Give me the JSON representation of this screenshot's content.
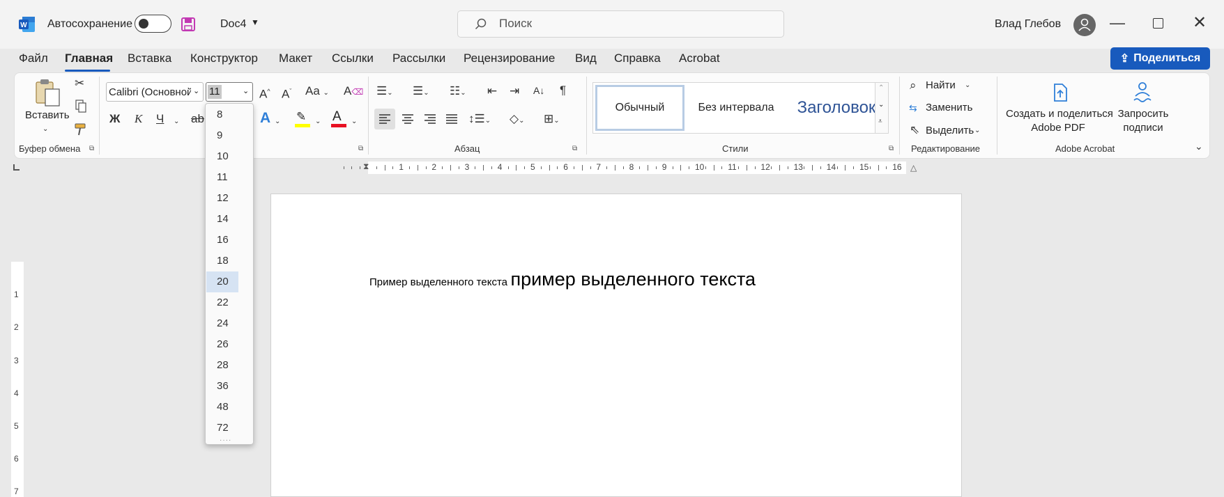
{
  "titlebar": {
    "autosave_label": "Автосохранение",
    "doc_name": "Doc4",
    "search_placeholder": "Поиск",
    "user_name": "Влад Глебов"
  },
  "menu": {
    "tabs": [
      "Файл",
      "Главная",
      "Вставка",
      "Конструктор",
      "Макет",
      "Ссылки",
      "Рассылки",
      "Рецензирование",
      "Вид",
      "Справка",
      "Acrobat"
    ],
    "active_tab": "Главная",
    "share_label": "Поделиться"
  },
  "ribbon": {
    "clipboard": {
      "paste_label": "Вставить",
      "group_label": "Буфер обмена"
    },
    "font": {
      "font_name": "Calibri (Основной",
      "font_size": "11",
      "bold": "Ж",
      "italic": "К",
      "underline": "Ч",
      "strike": "ab",
      "grow": "A^",
      "shrink": "A˅",
      "case": "Aa"
    },
    "paragraph": {
      "group_label": "Абзац"
    },
    "styles": {
      "items": [
        "Обычный",
        "Без интервала",
        "Заголовок"
      ],
      "group_label": "Стили"
    },
    "editing": {
      "find": "Найти",
      "replace": "Заменить",
      "select": "Выделить",
      "group_label": "Редактирование"
    },
    "acrobat": {
      "create_pdf_l1": "Создать и поделиться",
      "create_pdf_l2": "Adobe PDF",
      "sign_l1": "Запросить",
      "sign_l2": "подписи",
      "group_label": "Adobe Acrobat"
    }
  },
  "font_size_dropdown": {
    "options": [
      "8",
      "9",
      "10",
      "11",
      "12",
      "14",
      "16",
      "18",
      "20",
      "22",
      "24",
      "26",
      "28",
      "36",
      "48",
      "72"
    ],
    "highlighted": "20"
  },
  "ruler": {
    "h_ticks": [
      "1",
      "2",
      "3",
      "4",
      "5",
      "6",
      "7",
      "8",
      "9",
      "10",
      "11",
      "12",
      "13",
      "14",
      "15",
      "16"
    ],
    "v_ticks": [
      "1",
      "2",
      "3",
      "4",
      "5",
      "6",
      "7"
    ]
  },
  "document": {
    "text_small": "Пример выделенного текста",
    "text_large": "пример выделенного текста"
  },
  "colors": {
    "accent": "#185abd",
    "highlight_yellow": "#ffff00",
    "font_red": "#e81123",
    "style_heading": "#2f5496"
  }
}
